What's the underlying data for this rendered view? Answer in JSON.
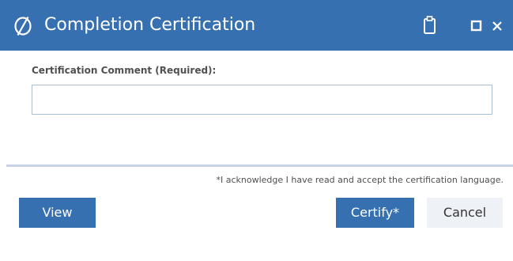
{
  "dialog": {
    "title": "Completion Certification",
    "logo_icon": "oval-slash-logo-icon",
    "controls": {
      "clipboard_icon": "clipboard-icon",
      "maximize_icon": "maximize-icon",
      "close_icon": "close-icon"
    }
  },
  "form": {
    "comment_label": "Certification Comment (Required):",
    "comment_value": "",
    "comment_placeholder": ""
  },
  "footer": {
    "acknowledgement": "*I acknowledge I have read and accept the certification language.",
    "view_label": "View",
    "certify_label": "Certify*",
    "cancel_label": "Cancel"
  },
  "colors": {
    "title_bar": "#3670b0",
    "primary_button": "#3670b0",
    "secondary_button": "#eef1f6",
    "input_border": "#a9bfd6",
    "divider": "#c7d3e4"
  }
}
